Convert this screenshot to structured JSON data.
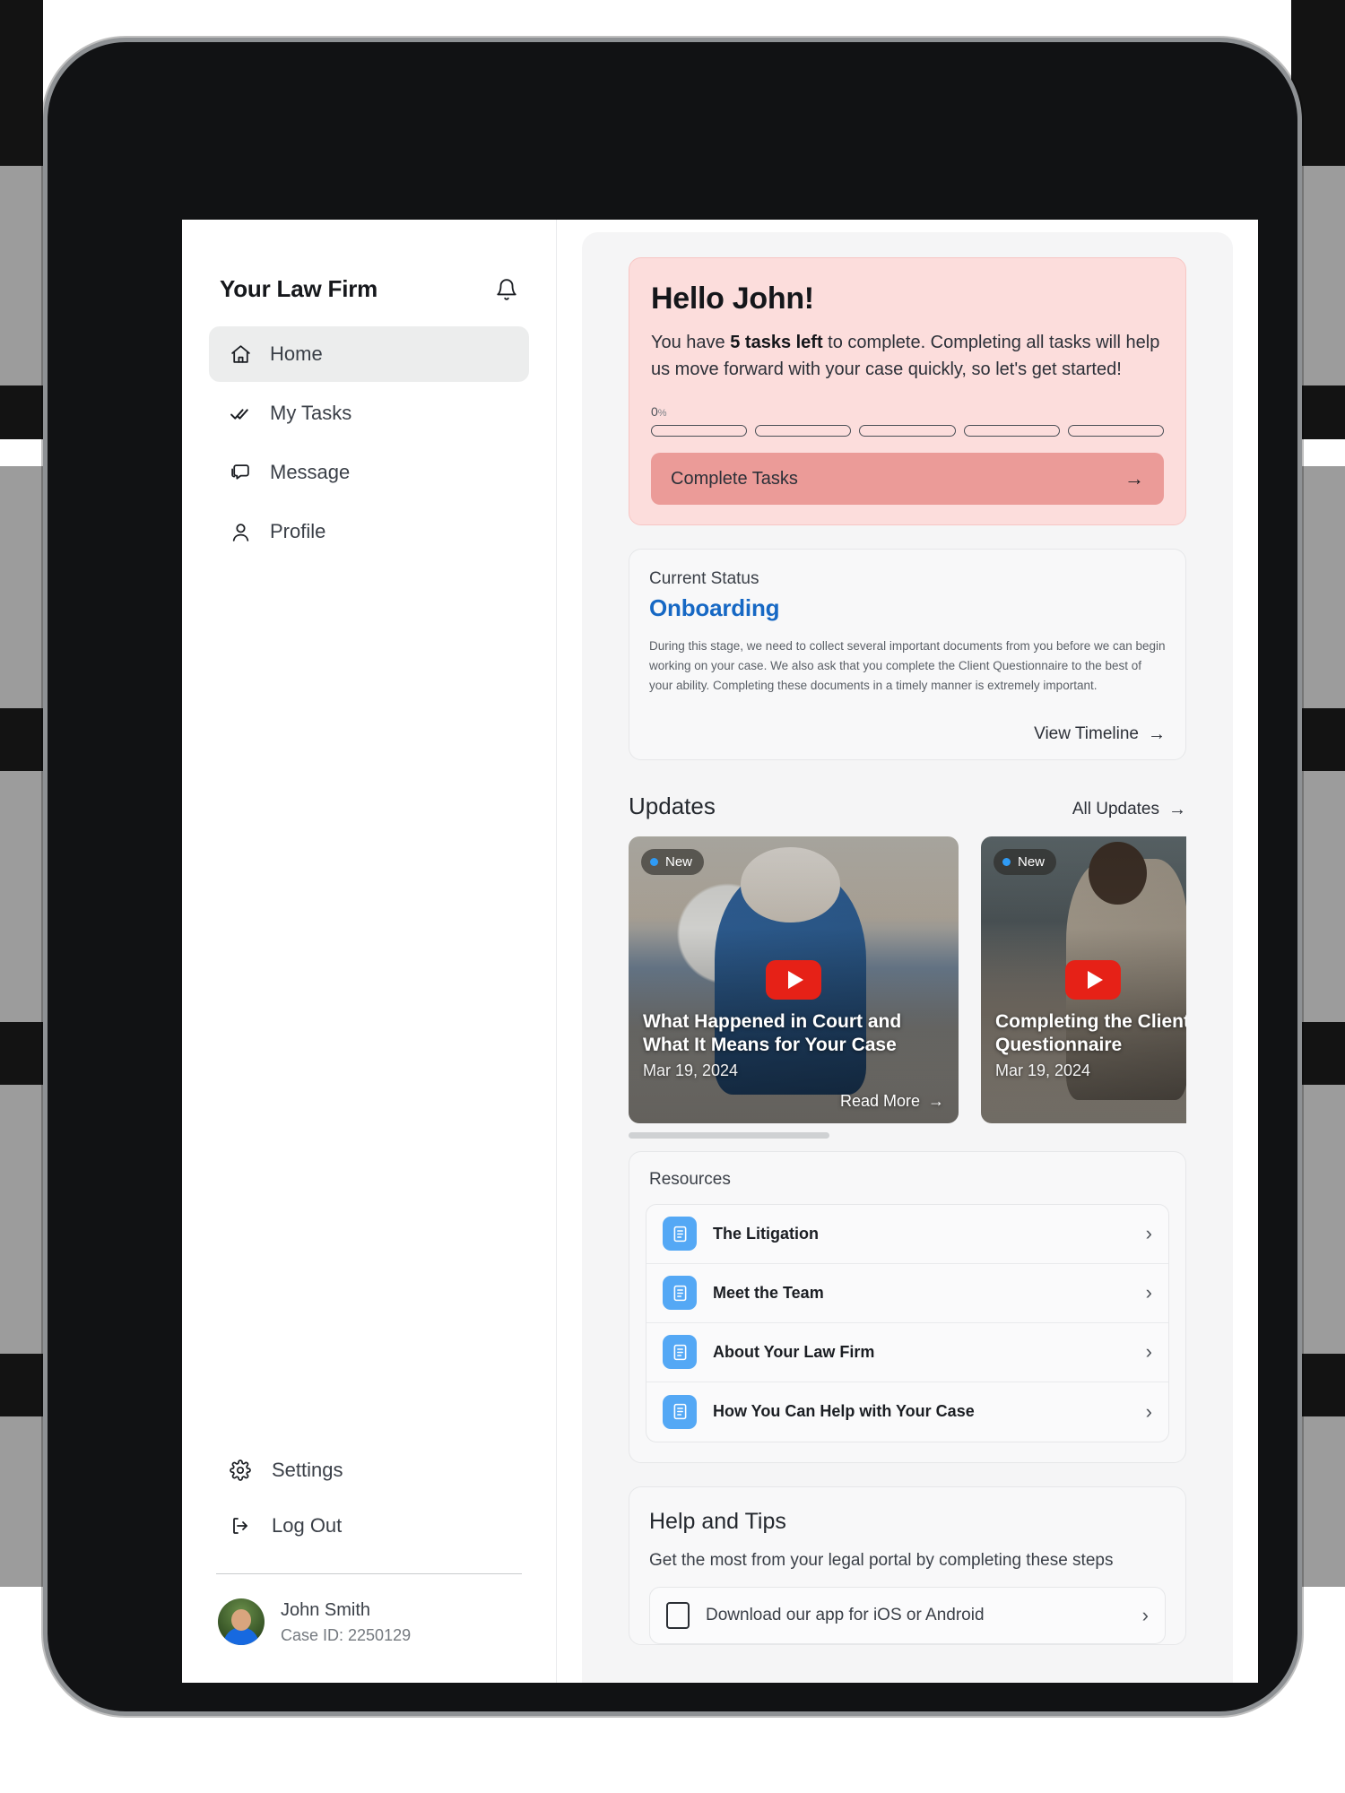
{
  "sidebar": {
    "brand": "Your Law Firm",
    "notification_icon": "bell-icon",
    "nav": [
      {
        "label": "Home",
        "icon": "home-icon",
        "active": true
      },
      {
        "label": "My Tasks",
        "icon": "double-check-icon",
        "active": false
      },
      {
        "label": "Message",
        "icon": "chat-icon",
        "active": false
      },
      {
        "label": "Profile",
        "icon": "person-icon",
        "active": false
      }
    ],
    "settings_label": "Settings",
    "logout_label": "Log Out",
    "user": {
      "name": "John Smith",
      "case_id": "Case ID: 2250129"
    }
  },
  "hello_card": {
    "heading": "Hello John!",
    "body_prefix": "You have ",
    "body_bold": "5 tasks left",
    "body_suffix": " to complete. Completing all tasks will help us move forward with your case quickly, so let's get started!",
    "progress_value": "0",
    "progress_unit": "%",
    "progress_segments": 5,
    "progress_filled": 0,
    "cta_label": "Complete Tasks",
    "cta_arrow": "→",
    "accent": "#eb9b98",
    "background": "#fcdddc"
  },
  "status_card": {
    "kicker": "Current Status",
    "status": "Onboarding",
    "status_color": "#1668c4",
    "description": "During this stage, we need to collect several important documents from you before we can begin working on your case. We also ask that you complete the Client Questionnaire to the best of your ability. Completing these documents in a timely manner is extremely important.",
    "link_label": "View Timeline",
    "link_arrow": "→"
  },
  "updates": {
    "title": "Updates",
    "all_label": "All Updates",
    "all_arrow": "→",
    "badge_label": "New",
    "read_more_label": "Read More",
    "read_more_arrow": "→",
    "cards": [
      {
        "title": "What Happened in Court and What It Means for Your Case",
        "date": "Mar 19, 2024",
        "badge": "New",
        "play_icon": "play-icon"
      },
      {
        "title": "Completing the Client Questionnaire",
        "date": "Mar 19, 2024",
        "badge": "New",
        "play_icon": "play-icon"
      }
    ]
  },
  "resources": {
    "title": "Resources",
    "items": [
      {
        "label": "The Litigation",
        "icon": "document-icon"
      },
      {
        "label": "Meet the Team",
        "icon": "document-icon"
      },
      {
        "label": "About Your Law Firm",
        "icon": "document-icon"
      },
      {
        "label": "How You Can Help with Your Case",
        "icon": "document-icon"
      }
    ]
  },
  "help_and_tips": {
    "title": "Help and Tips",
    "subtitle": "Get the most from your legal portal by completing these steps",
    "items": [
      {
        "label": "Download our app for iOS or Android",
        "icon": "phone-icon"
      }
    ]
  }
}
